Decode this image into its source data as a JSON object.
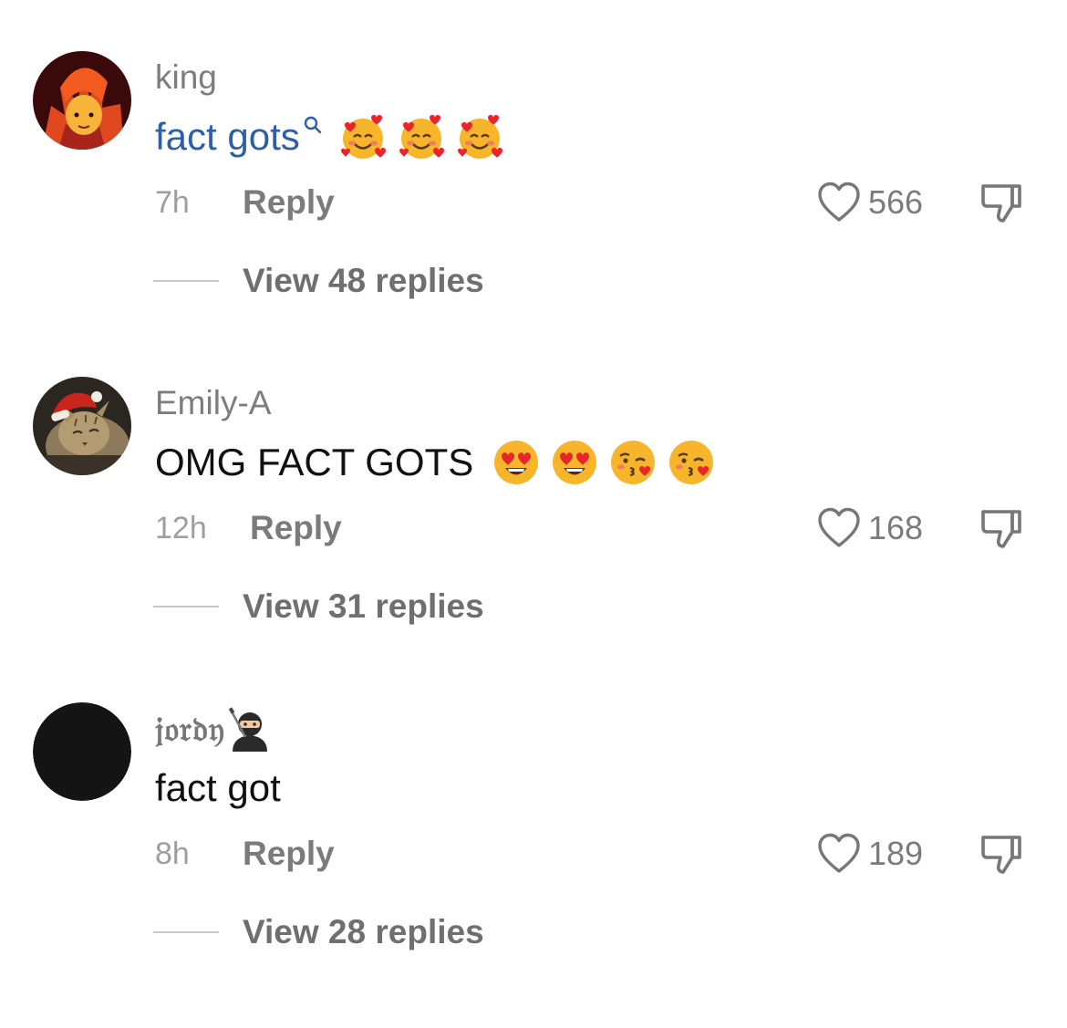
{
  "comments": [
    {
      "username": "king",
      "text": "fact gots",
      "emojis": [
        "smiling-face-with-hearts",
        "smiling-face-with-hearts",
        "smiling-face-with-hearts"
      ],
      "time": "7h",
      "reply_label": "Reply",
      "likes": "566",
      "view_replies": "View 48 replies"
    },
    {
      "username": "Emily-A",
      "text": "OMG FACT GOTS",
      "emojis": [
        "heart-eyes",
        "heart-eyes",
        "kissing-face",
        "kissing-face"
      ],
      "time": "12h",
      "reply_label": "Reply",
      "likes": "168",
      "view_replies": "View 31 replies"
    },
    {
      "username": "𝔧𝔬𝔯𝔡𝔶",
      "username_emoji": "ninja",
      "text": "fact got",
      "time": "8h",
      "reply_label": "Reply",
      "likes": "189",
      "view_replies": "View 28 replies"
    }
  ],
  "colors": {
    "link": "#2e5ea8",
    "muted": "#7b7b7b",
    "text": "#111111"
  }
}
